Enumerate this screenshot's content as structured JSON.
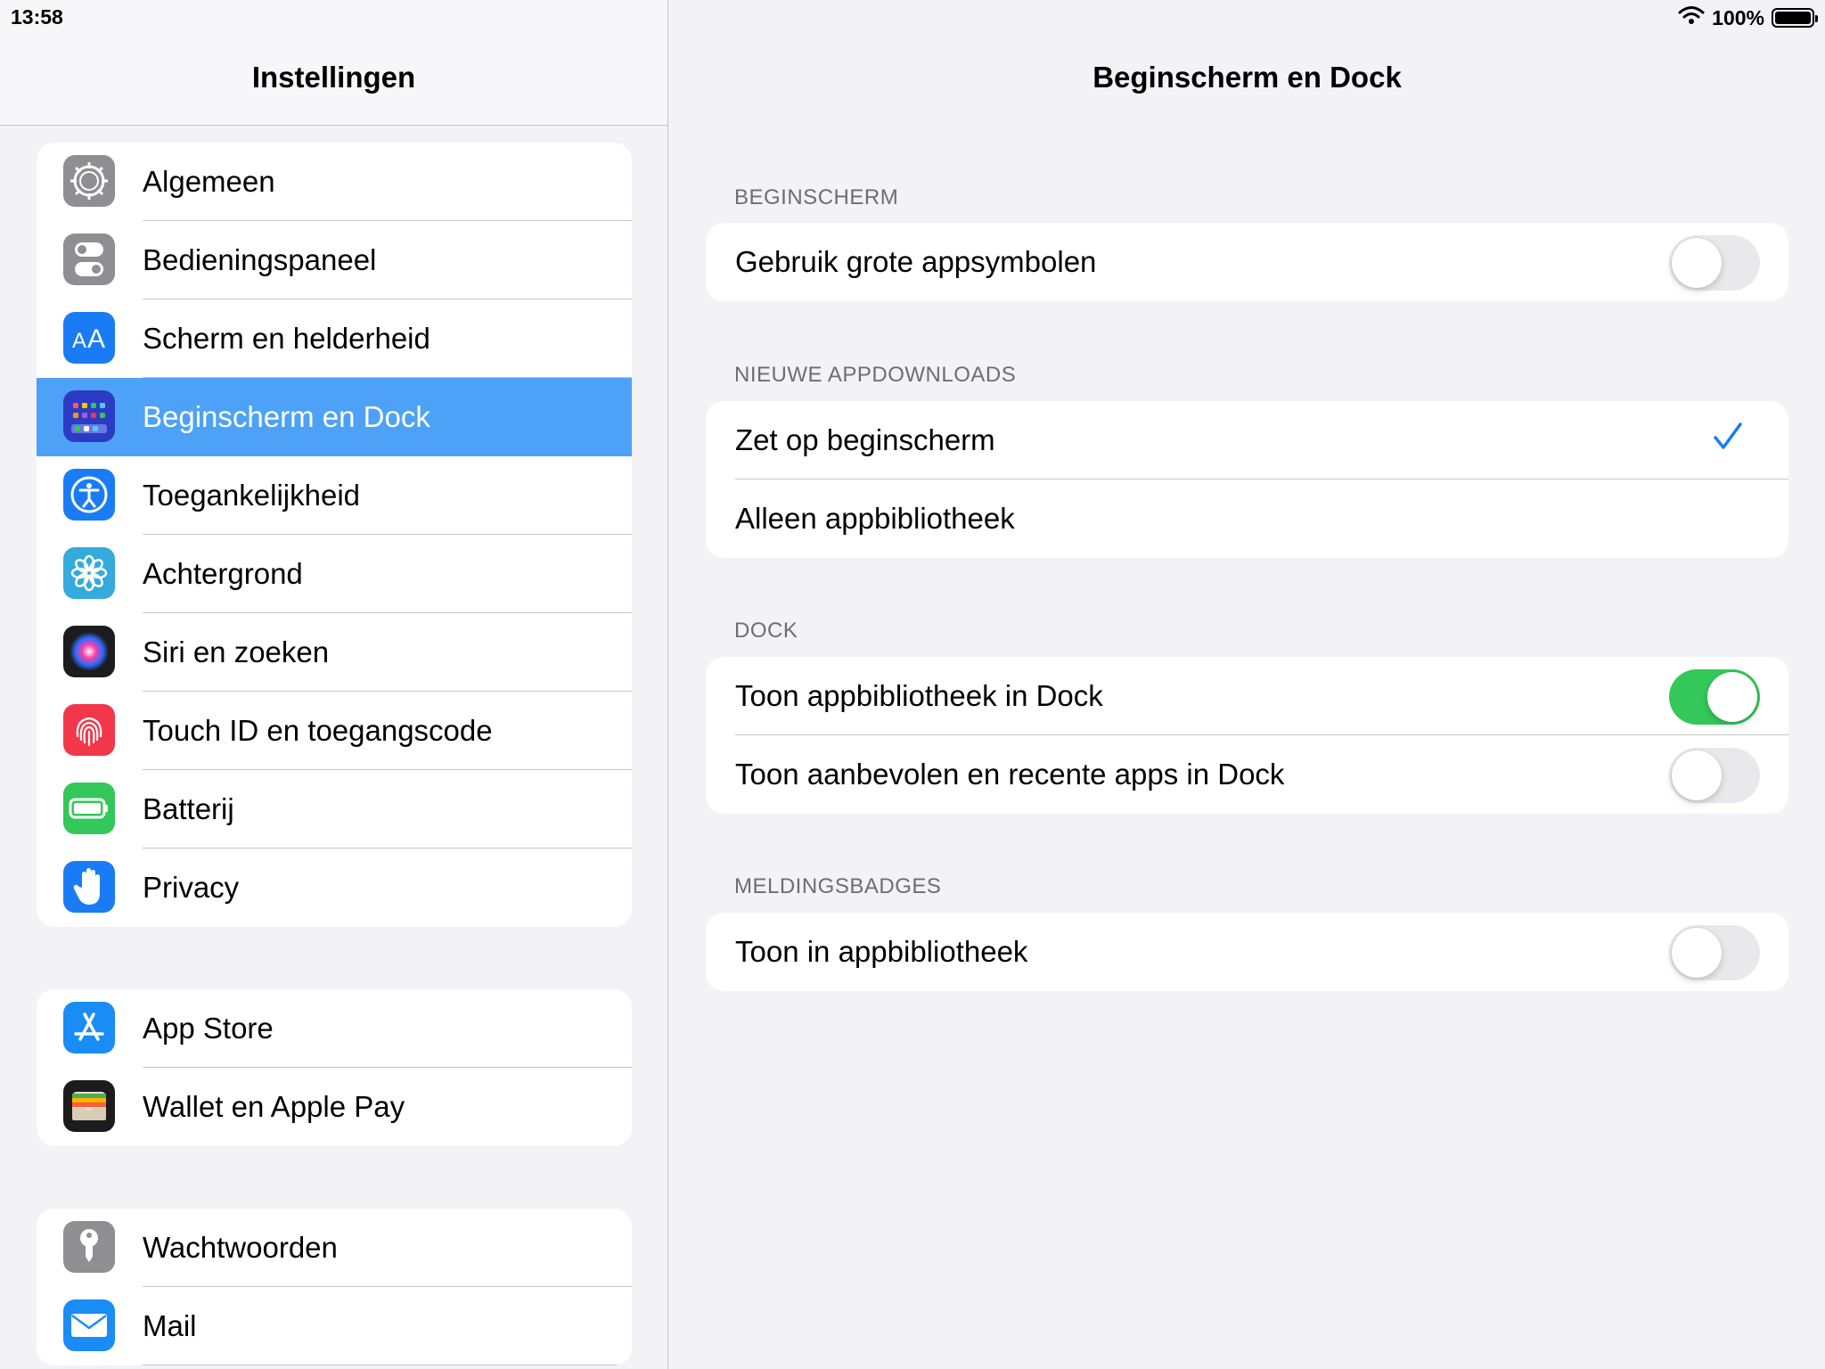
{
  "status": {
    "time": "13:58",
    "battery": "100%",
    "battery_level": 1.0
  },
  "sidebar": {
    "title": "Instellingen",
    "groups": [
      {
        "items": [
          {
            "label": "Algemeen",
            "icon": "gear-icon",
            "color": "#8e8e93"
          },
          {
            "label": "Bedieningspaneel",
            "icon": "toggles-icon",
            "color": "#8e8e93"
          },
          {
            "label": "Scherm en helderheid",
            "icon": "text-size-icon",
            "color": "#1a7cf5"
          },
          {
            "label": "Beginscherm en Dock",
            "icon": "home-grid-icon",
            "color": "#2c3bc4",
            "selected": true
          },
          {
            "label": "Toegankelijkheid",
            "icon": "accessibility-icon",
            "color": "#1a7cf5"
          },
          {
            "label": "Achtergrond",
            "icon": "flower-icon",
            "color": "#35aadc"
          },
          {
            "label": "Siri en zoeken",
            "icon": "siri-icon",
            "color": "#1c1c1e"
          },
          {
            "label": "Touch ID en toegangscode",
            "icon": "fingerprint-icon",
            "color": "#f2374a"
          },
          {
            "label": "Batterij",
            "icon": "battery-icon",
            "color": "#34c759"
          },
          {
            "label": "Privacy",
            "icon": "hand-icon",
            "color": "#1a7cf5"
          }
        ]
      },
      {
        "items": [
          {
            "label": "App Store",
            "icon": "app-store-icon",
            "color": "#1a8cf5"
          },
          {
            "label": "Wallet en Apple Pay",
            "icon": "wallet-icon",
            "color": "#1c1c1e"
          }
        ]
      },
      {
        "items": [
          {
            "label": "Wachtwoorden",
            "icon": "key-icon",
            "color": "#8e8e93"
          },
          {
            "label": "Mail",
            "icon": "mail-icon",
            "color": "#1a8cf5"
          }
        ]
      }
    ]
  },
  "detail": {
    "title": "Beginscherm en Dock",
    "sections": [
      {
        "header": "BEGINSCHERM",
        "rows": [
          {
            "label": "Gebruik grote appsymbolen",
            "control": "toggle",
            "on": false
          }
        ]
      },
      {
        "header": "NIEUWE APPDOWNLOADS",
        "rows": [
          {
            "label": "Zet op beginscherm",
            "control": "check",
            "checked": true
          },
          {
            "label": "Alleen appbibliotheek",
            "control": "check",
            "checked": false
          }
        ]
      },
      {
        "header": "DOCK",
        "rows": [
          {
            "label": "Toon appbibliotheek in Dock",
            "control": "toggle",
            "on": true
          },
          {
            "label": "Toon aanbevolen en recente apps in Dock",
            "control": "toggle",
            "on": false
          }
        ]
      },
      {
        "header": "MELDINGSBADGES",
        "rows": [
          {
            "label": "Toon in appbibliotheek",
            "control": "toggle",
            "on": false
          }
        ]
      }
    ]
  }
}
